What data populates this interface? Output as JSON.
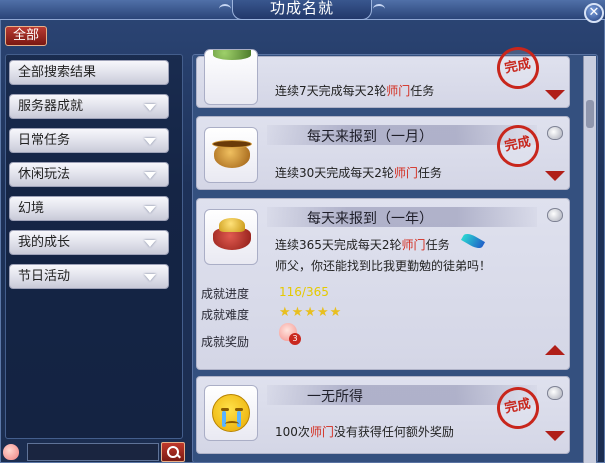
{
  "window": {
    "title": "功成名就",
    "close_label": "✕"
  },
  "filter": {
    "all_label": "全部"
  },
  "sidebar": {
    "items": [
      {
        "label": "全部搜索结果",
        "has_arrow": false
      },
      {
        "label": "服务器成就",
        "has_arrow": true
      },
      {
        "label": "日常任务",
        "has_arrow": true
      },
      {
        "label": "休闲玩法",
        "has_arrow": true
      },
      {
        "label": "幻境",
        "has_arrow": true
      },
      {
        "label": "我的成长",
        "has_arrow": true
      },
      {
        "label": "节日活动",
        "has_arrow": true
      }
    ],
    "search": {
      "value": "",
      "placeholder": ""
    }
  },
  "achievements": [
    {
      "name": "",
      "desc_pre": "连续7天完成每天2轮",
      "desc_hl": "师门",
      "desc_post": "任务",
      "completed": true,
      "seal_text": "完成",
      "icon": "fruit-bowl-icon"
    },
    {
      "name": "每天来报到（一月）",
      "desc_pre": "连续30天完成每天2轮",
      "desc_hl": "师门",
      "desc_post": "任务",
      "completed": true,
      "seal_text": "完成",
      "icon": "golden-pot-icon"
    },
    {
      "name": "每天来报到（一年）",
      "desc_pre": "连续365天完成每天2轮",
      "desc_hl": "师门",
      "desc_post": "任务",
      "quote": "师父，你还能找到比我更勤勉的徒弟吗！",
      "completed": false,
      "expanded": true,
      "icon": "treasure-basin-icon",
      "progress_label": "成就进度",
      "progress_value": "116/365",
      "progress_fraction": 0.3178,
      "difficulty_label": "成就难度",
      "difficulty_stars": "★★★★★",
      "difficulty_level": 5,
      "reward_label": "成就奖励",
      "reward_icon": "peach-icon",
      "reward_count": "3"
    },
    {
      "name": "一无所得",
      "desc_pre": "100次",
      "desc_hl": "师门",
      "desc_post": "没有获得任何额外奖励",
      "completed": true,
      "seal_text": "完成",
      "icon": "crying-face-icon"
    }
  ],
  "colors": {
    "highlight": "#d42b1d",
    "progress": "#e5c900",
    "seal": "#c8261c",
    "frame": "#233a63"
  }
}
